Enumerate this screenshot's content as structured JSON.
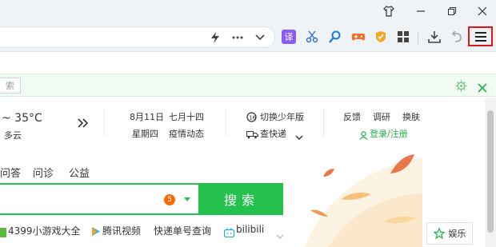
{
  "window": {
    "skin_icon": "shirt-icon",
    "minimize_icon": "minimize-icon",
    "maximize_icon": "restore-icon",
    "close_icon": "close-icon"
  },
  "toolbar": {
    "address_icons": [
      "lightning-icon",
      "more-dots-icon",
      "chevron-down-icon"
    ],
    "extensions": [
      "translate-icon",
      "scissors-icon",
      "search-magnify-icon",
      "gamepad-icon",
      "shield-icon",
      "apps-grid-icon"
    ],
    "download_icon": "download-icon",
    "undo_icon": "undo-icon",
    "menu_icon": "hamburger-menu-icon",
    "translate_label": "译"
  },
  "notice": {
    "field_text": "索",
    "settings_icon": "gear-icon",
    "close_icon": "close-icon"
  },
  "weather": {
    "temp": "~ 35°C",
    "condition": "多云"
  },
  "date": {
    "line1_date": "8月11日",
    "line1_lunar": "七月十四",
    "line2_weekday": "星期四",
    "line2_link": "疫情动态"
  },
  "tools": {
    "teen_mode": "切换少年版",
    "express": "查快递"
  },
  "user_links": {
    "feedback": "反馈",
    "survey": "调研",
    "skin": "换肤",
    "login": "登录/注册"
  },
  "search": {
    "tabs": [
      "问答",
      "问诊",
      "公益"
    ],
    "badge_count": "5",
    "button_label": "搜索"
  },
  "quick_links": [
    "4399小游戏大全",
    "腾讯视频",
    "快递单号查询",
    "bilibili"
  ],
  "side": {
    "entertainment": "娱乐"
  },
  "colors": {
    "brand_green": "#24c24d",
    "highlight_red": "#e3161b",
    "badge_orange": "#ff6a00"
  }
}
